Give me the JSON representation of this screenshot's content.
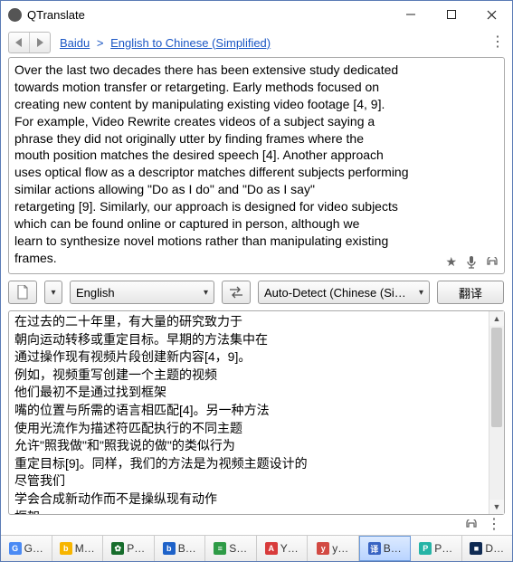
{
  "window": {
    "title": "QTranslate"
  },
  "nav": {
    "crumb_service": "Baidu",
    "crumb_pair": "English to Chinese (Simplified)"
  },
  "source": {
    "text": "Over the last two decades there has been extensive study dedicated\ntowards motion transfer or retargeting. Early methods focused on\ncreating new content by manipulating existing video footage [4, 9].\nFor example, Video Rewrite creates videos of a subject saying a\nphrase they did not originally utter by finding frames where the\nmouth position matches the desired speech [4]. Another approach\nuses optical flow as a descriptor matches different subjects performing\nsimilar actions allowing \"Do as I do\" and \"Do as I say\"\nretargeting [9]. Similarly, our approach is designed for video subjects\nwhich can be found online or captured in person, although we\nlearn to synthesize novel motions rather than manipulating existing\nframes."
  },
  "toolbar": {
    "src_lang": "English",
    "tgt_lang": "Auto-Detect (Chinese (Si…",
    "translate_label": "翻译"
  },
  "output": {
    "text": "在过去的二十年里，有大量的研究致力于\n朝向运动转移或重定目标。早期的方法集中在\n通过操作现有视频片段创建新内容[4，9]。\n例如，视频重写创建一个主题的视频\n他们最初不是通过找到框架\n嘴的位置与所需的语言相匹配[4]。另一种方法\n使用光流作为描述符匹配执行的不同主题\n允许\"照我做\"和\"照我说的做\"的类似行为\n重定目标[9]。同样，我们的方法是为视频主题设计的\n尽管我们\n学会合成新动作而不是操纵现有动作\n框架。"
  },
  "services": [
    {
      "label": "G…",
      "color": "#4a8af4",
      "letter": "G",
      "selected": false
    },
    {
      "label": "M…",
      "color": "#f7b500",
      "letter": "b",
      "selected": false
    },
    {
      "label": "P…",
      "color": "#176d2c",
      "letter": "✿",
      "selected": false
    },
    {
      "label": "B…",
      "color": "#1e62c9",
      "letter": "b",
      "selected": false
    },
    {
      "label": "S…",
      "color": "#2e9b46",
      "letter": "≡",
      "selected": false
    },
    {
      "label": "Y…",
      "color": "#d83b3b",
      "letter": "A",
      "selected": false
    },
    {
      "label": "y…",
      "color": "#d24a43",
      "letter": "y",
      "selected": false
    },
    {
      "label": "B…",
      "color": "#3964c3",
      "letter": "译",
      "selected": true
    },
    {
      "label": "P…",
      "color": "#25b4a6",
      "letter": "P",
      "selected": false
    },
    {
      "label": "D…",
      "color": "#0f2a52",
      "letter": "■",
      "selected": false
    }
  ]
}
